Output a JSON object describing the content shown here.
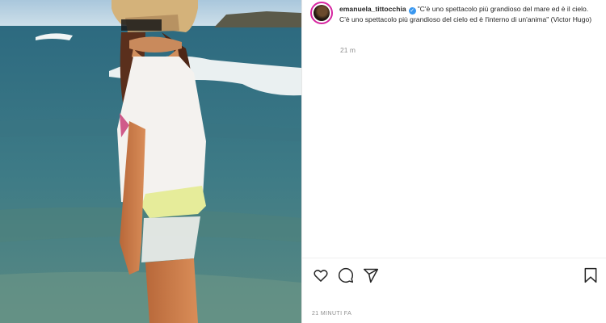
{
  "post": {
    "username": "emanuela_tittocchia",
    "verified_icon": "verified-badge-icon",
    "caption": "\"C'è uno spettacolo più grandioso del mare ed è il cielo. C'è uno spettacolo più grandioso del cielo ed è l'interno di un'anima\" (Victor Hugo)",
    "caption_age": "21 m",
    "timestamp": "21 MINUTI FA"
  },
  "actions": {
    "like_icon": "heart-icon",
    "comment_icon": "comment-icon",
    "share_icon": "paper-plane-icon",
    "save_icon": "bookmark-icon"
  },
  "colors": {
    "text": "#262626",
    "secondary": "#8e8e8e",
    "verified": "#3897f0",
    "avatar_ring": "#d6249f",
    "divider": "#efefef"
  }
}
